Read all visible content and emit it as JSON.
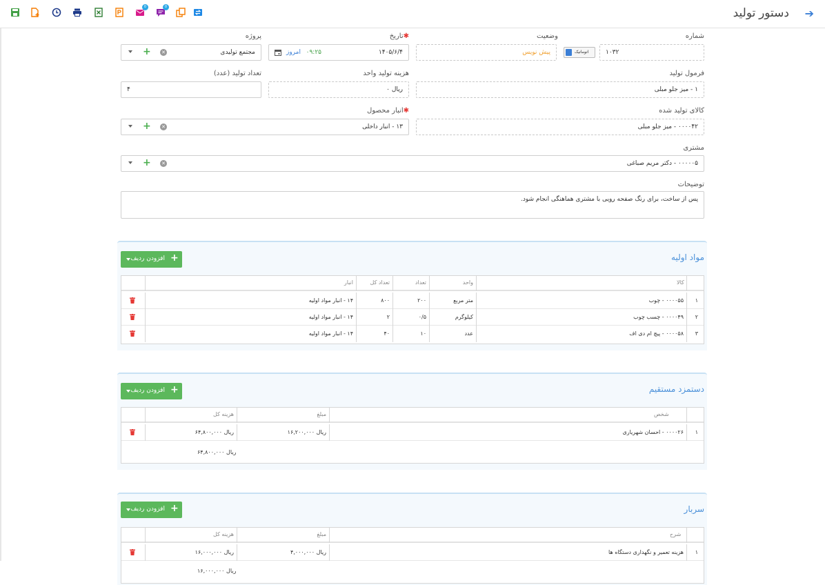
{
  "header": {
    "title": "دستور تولید",
    "toolbar_icons": [
      "save-icon",
      "new-document-icon",
      "history-icon",
      "print-icon",
      "excel-icon",
      "pdf-icon",
      "message-icon",
      "chat-icon",
      "copy-icon",
      "transfer-icon"
    ],
    "badges": {
      "message": "0",
      "chat": "0"
    }
  },
  "form": {
    "number": {
      "label": "شماره",
      "value": "۱۰۳۲",
      "auto_label": "اتوماتیک"
    },
    "status": {
      "label": "وضعیت",
      "value": "پیش نویس"
    },
    "date": {
      "label": "تاریخ",
      "value": "۱۴۰۵/۶/۴",
      "time": "۰۹:۲۵",
      "today": "امروز"
    },
    "project": {
      "label": "پروژه",
      "value": "مجتمع تولیدی"
    },
    "formula": {
      "label": "فرمول تولید",
      "value": "۱ - میز جلو مبلی"
    },
    "unit_cost": {
      "label": "هزینه تولید واحد",
      "value": "ریال ۰"
    },
    "quantity": {
      "label": "تعداد تولید (عدد)",
      "value": "۴"
    },
    "product": {
      "label": "کالای تولید شده",
      "value": "۰۰۰۰۴۲ - میز جلو مبلی"
    },
    "warehouse": {
      "label": "انبار محصول",
      "value": "۱۳ - انبار داخلی"
    },
    "customer": {
      "label": "مشتری",
      "value": "۰۰۰۰۰۵ - دکتر مریم صباغی"
    },
    "notes": {
      "label": "توضیحات",
      "value": "پس از ساخت، برای رنگ صفحه رویی با مشتری هماهنگی انجام شود."
    }
  },
  "materials": {
    "title": "مواد اولیه",
    "add_label": "افزودن ردیف",
    "columns": {
      "item": "کالا",
      "unit": "واحد",
      "qty": "تعداد",
      "total_qty": "تعداد کل",
      "warehouse": "انبار"
    },
    "rows": [
      {
        "num": "۱",
        "item": "۰۰۰۰۵۵ - چوب",
        "unit": "متر مربع",
        "qty": "۲۰۰",
        "total_qty": "۸۰۰",
        "warehouse": "۱۴ - انبار مواد اولیه"
      },
      {
        "num": "۲",
        "item": "۰۰۰۰۴۹ - چسب چوب",
        "unit": "کیلوگرم",
        "qty": "۰/۵",
        "total_qty": "۲",
        "warehouse": "۱۴ - انبار مواد اولیه"
      },
      {
        "num": "۳",
        "item": "۰۰۰۰۵۸ - پیچ ام دی اف",
        "unit": "عدد",
        "qty": "۱۰",
        "total_qty": "۴۰",
        "warehouse": "۱۴ - انبار مواد اولیه"
      }
    ]
  },
  "labor": {
    "title": "دستمزد مستقیم",
    "add_label": "افزودن ردیف",
    "columns": {
      "person": "شخص",
      "amount": "مبلغ",
      "total": "هزینه کل"
    },
    "rows": [
      {
        "num": "۱",
        "person": "۰۰۰۰۲۶ - احسان شهریاری",
        "amount": "ریال ۱۶,۲۰۰,۰۰۰",
        "total": "ریال ۶۴,۸۰۰,۰۰۰"
      }
    ],
    "sum": "ریال ۶۴,۸۰۰,۰۰۰"
  },
  "overhead": {
    "title": "سربار",
    "add_label": "افزودن ردیف",
    "columns": {
      "desc": "شرح",
      "amount": "مبلغ",
      "total": "هزینه کل"
    },
    "rows": [
      {
        "num": "۱",
        "desc": "هزینه تعمیر و نگهداری دستگاه ها",
        "amount": "ریال ۴,۰۰۰,۰۰۰",
        "total": "ریال ۱۶,۰۰۰,۰۰۰"
      }
    ],
    "sum": "ریال ۱۶,۰۰۰,۰۰۰"
  },
  "colors": {
    "accent": "#3b7fd6",
    "success": "#5cb85c",
    "danger": "#e53935",
    "draft": "#f0a030"
  }
}
